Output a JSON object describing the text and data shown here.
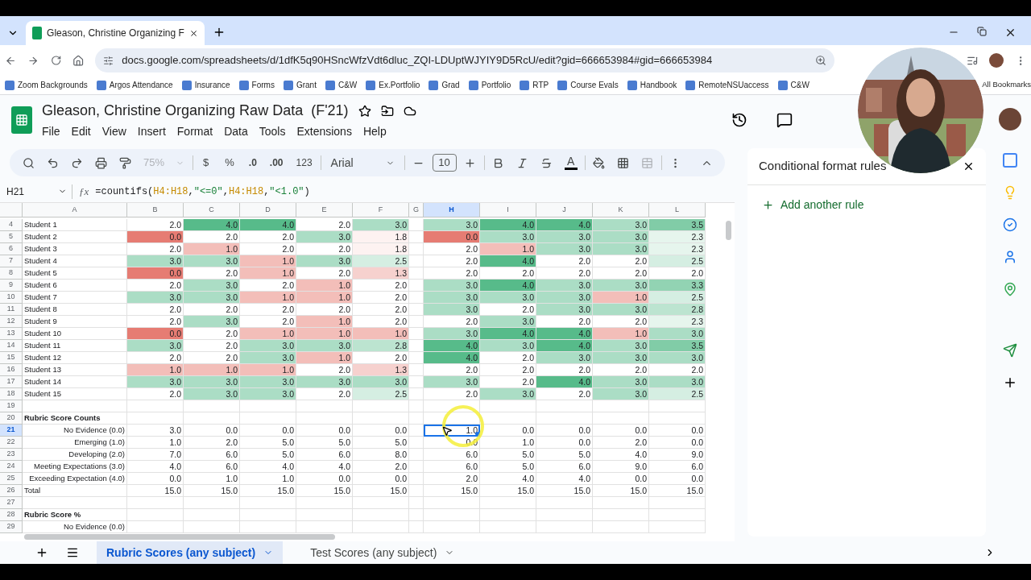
{
  "browser": {
    "tab_title": "Gleason, Christine Organizing F",
    "url": "docs.google.com/spreadsheets/d/1dfK5q90HSncWfzVdt6dluc_ZQI-LDUptWJYIY9D5RcU/edit?gid=666653984#gid=666653984",
    "bookmarks": [
      "Zoom Backgrounds",
      "Argos Attendance",
      "Insurance",
      "Forms",
      "Grant",
      "C&W",
      "Ex.Portfolio",
      "Grad",
      "Portfolio",
      "RTP",
      "Course Evals",
      "Handbook",
      "RemoteNSUaccess",
      "C&W"
    ],
    "all_bookmarks": "All Bookmarks"
  },
  "doc": {
    "title": "Gleason, Christine Organizing Raw Data  (F'21)",
    "menus": [
      "File",
      "Edit",
      "View",
      "Insert",
      "Format",
      "Data",
      "Tools",
      "Extensions",
      "Help"
    ]
  },
  "toolbar": {
    "zoom": "75%",
    "currency": "$",
    "percent": "%",
    "decrease_decimals": ".0",
    "increase_decimals": ".00",
    "number_format": "123",
    "font": "Arial",
    "font_size": "10",
    "text_color": "A"
  },
  "formula_bar": {
    "cell": "H21",
    "function_label": "ƒx",
    "formula": [
      {
        "kind": "plain",
        "text": "=countifs("
      },
      {
        "kind": "range",
        "text": "H4:H18"
      },
      {
        "kind": "plain",
        "text": ","
      },
      {
        "kind": "string",
        "text": "\"<=0\""
      },
      {
        "kind": "plain",
        "text": ","
      },
      {
        "kind": "range",
        "text": "H4:H18"
      },
      {
        "kind": "plain",
        "text": ","
      },
      {
        "kind": "string",
        "text": "\"<1.0\""
      },
      {
        "kind": "plain",
        "text": ")"
      }
    ]
  },
  "columns": [
    {
      "label": "A",
      "kind": "label",
      "selected": false
    },
    {
      "label": "B",
      "kind": "value",
      "selected": false
    },
    {
      "label": "C",
      "kind": "value",
      "selected": false
    },
    {
      "label": "D",
      "kind": "value",
      "selected": false
    },
    {
      "label": "E",
      "kind": "value",
      "selected": false
    },
    {
      "label": "F",
      "kind": "value",
      "selected": false
    },
    {
      "label": "G",
      "kind": "spacer",
      "selected": false
    },
    {
      "label": "H",
      "kind": "value",
      "selected": true
    },
    {
      "label": "I",
      "kind": "value",
      "selected": false
    },
    {
      "label": "J",
      "kind": "value",
      "selected": false
    },
    {
      "label": "K",
      "kind": "value",
      "selected": false
    },
    {
      "label": "L",
      "kind": "value",
      "selected": false
    }
  ],
  "rows": [
    {
      "number": "4",
      "kind": "scores",
      "selected": false,
      "label": "Student 1",
      "values": [
        "2.0",
        "4.0",
        "4.0",
        "2.0",
        "3.0",
        "3.0",
        "4.0",
        "4.0",
        "3.0",
        "3.5"
      ]
    },
    {
      "number": "5",
      "kind": "scores",
      "selected": false,
      "label": "Student 2",
      "values": [
        "0.0",
        "2.0",
        "2.0",
        "3.0",
        "1.8",
        "0.0",
        "3.0",
        "3.0",
        "3.0",
        "2.3"
      ]
    },
    {
      "number": "6",
      "kind": "scores",
      "selected": false,
      "label": "Student 3",
      "values": [
        "2.0",
        "1.0",
        "2.0",
        "2.0",
        "1.8",
        "2.0",
        "1.0",
        "3.0",
        "3.0",
        "2.3"
      ]
    },
    {
      "number": "7",
      "kind": "scores",
      "selected": false,
      "label": "Student 4",
      "values": [
        "3.0",
        "3.0",
        "1.0",
        "3.0",
        "2.5",
        "2.0",
        "4.0",
        "2.0",
        "2.0",
        "2.5"
      ]
    },
    {
      "number": "8",
      "kind": "scores",
      "selected": false,
      "label": "Student 5",
      "values": [
        "0.0",
        "2.0",
        "1.0",
        "2.0",
        "1.3",
        "2.0",
        "2.0",
        "2.0",
        "2.0",
        "2.0"
      ]
    },
    {
      "number": "9",
      "kind": "scores",
      "selected": false,
      "label": "Student 6",
      "values": [
        "2.0",
        "3.0",
        "2.0",
        "1.0",
        "2.0",
        "3.0",
        "4.0",
        "3.0",
        "3.0",
        "3.3"
      ]
    },
    {
      "number": "10",
      "kind": "scores",
      "selected": false,
      "label": "Student 7",
      "values": [
        "3.0",
        "3.0",
        "1.0",
        "1.0",
        "2.0",
        "3.0",
        "3.0",
        "3.0",
        "1.0",
        "2.5"
      ]
    },
    {
      "number": "11",
      "kind": "scores",
      "selected": false,
      "label": "Student 8",
      "values": [
        "2.0",
        "2.0",
        "2.0",
        "2.0",
        "2.0",
        "3.0",
        "2.0",
        "3.0",
        "3.0",
        "2.8"
      ]
    },
    {
      "number": "12",
      "kind": "scores",
      "selected": false,
      "label": "Student 9",
      "values": [
        "2.0",
        "3.0",
        "2.0",
        "1.0",
        "2.0",
        "2.0",
        "3.0",
        "2.0",
        "2.0",
        "2.3"
      ]
    },
    {
      "number": "13",
      "kind": "scores",
      "selected": false,
      "label": "Student 10",
      "values": [
        "0.0",
        "2.0",
        "1.0",
        "1.0",
        "1.0",
        "3.0",
        "4.0",
        "4.0",
        "1.0",
        "3.0"
      ]
    },
    {
      "number": "14",
      "kind": "scores",
      "selected": false,
      "label": "Student 11",
      "values": [
        "3.0",
        "2.0",
        "3.0",
        "3.0",
        "2.8",
        "4.0",
        "3.0",
        "4.0",
        "3.0",
        "3.5"
      ]
    },
    {
      "number": "15",
      "kind": "scores",
      "selected": false,
      "label": "Student 12",
      "values": [
        "2.0",
        "2.0",
        "3.0",
        "1.0",
        "2.0",
        "4.0",
        "2.0",
        "3.0",
        "3.0",
        "3.0"
      ]
    },
    {
      "number": "16",
      "kind": "scores",
      "selected": false,
      "label": "Student 13",
      "values": [
        "1.0",
        "1.0",
        "1.0",
        "2.0",
        "1.3",
        "2.0",
        "2.0",
        "2.0",
        "2.0",
        "2.0"
      ]
    },
    {
      "number": "17",
      "kind": "scores",
      "selected": false,
      "label": "Student 14",
      "values": [
        "3.0",
        "3.0",
        "3.0",
        "3.0",
        "3.0",
        "3.0",
        "2.0",
        "4.0",
        "3.0",
        "3.0"
      ]
    },
    {
      "number": "18",
      "kind": "scores",
      "selected": false,
      "label": "Student 15",
      "values": [
        "2.0",
        "3.0",
        "3.0",
        "2.0",
        "2.5",
        "2.0",
        "3.0",
        "2.0",
        "3.0",
        "2.5"
      ]
    },
    {
      "number": "19",
      "kind": "blank",
      "selected": false
    },
    {
      "number": "20",
      "kind": "heading",
      "selected": false,
      "label": "Rubric Score Counts"
    },
    {
      "number": "21",
      "kind": "counts",
      "selected": true,
      "label": "No Evidence (0.0)",
      "values": [
        "3.0",
        "0.0",
        "0.0",
        "0.0",
        "0.0",
        "1.0",
        "0.0",
        "0.0",
        "0.0",
        "0.0"
      ]
    },
    {
      "number": "22",
      "kind": "counts",
      "selected": false,
      "label": "Emerging (1.0)",
      "values": [
        "1.0",
        "2.0",
        "5.0",
        "5.0",
        "5.0",
        "0.0",
        "1.0",
        "0.0",
        "2.0",
        "0.0"
      ]
    },
    {
      "number": "23",
      "kind": "counts",
      "selected": false,
      "label": "Developing (2.0)",
      "values": [
        "7.0",
        "6.0",
        "5.0",
        "6.0",
        "8.0",
        "6.0",
        "5.0",
        "5.0",
        "4.0",
        "9.0"
      ]
    },
    {
      "number": "24",
      "kind": "counts",
      "selected": false,
      "label": "Meeting Expectations (3.0)",
      "values": [
        "4.0",
        "6.0",
        "4.0",
        "4.0",
        "2.0",
        "6.0",
        "5.0",
        "6.0",
        "9.0",
        "6.0"
      ]
    },
    {
      "number": "25",
      "kind": "counts",
      "selected": false,
      "label": "Exceeding Expectation (4.0)",
      "values": [
        "0.0",
        "1.0",
        "1.0",
        "0.0",
        "0.0",
        "2.0",
        "4.0",
        "4.0",
        "0.0",
        "0.0"
      ]
    },
    {
      "number": "26",
      "kind": "total",
      "selected": false,
      "label": "Total",
      "values": [
        "15.0",
        "15.0",
        "15.0",
        "15.0",
        "15.0",
        "15.0",
        "15.0",
        "15.0",
        "15.0",
        "15.0"
      ]
    },
    {
      "number": "27",
      "kind": "blank",
      "selected": false
    },
    {
      "number": "28",
      "kind": "heading",
      "selected": false,
      "label": "Rubric Score %"
    },
    {
      "number": "29",
      "kind": "counts",
      "selected": false,
      "label": "No Evidence (0.0)"
    }
  ],
  "sheet_tabs": [
    {
      "label": "Rubric Scores (any subject)",
      "selected": true
    },
    {
      "label": "Test Scores (any subject)",
      "selected": false
    }
  ],
  "side_panel": {
    "title": "Conditional format rules",
    "add_rule": "Add another rule"
  }
}
